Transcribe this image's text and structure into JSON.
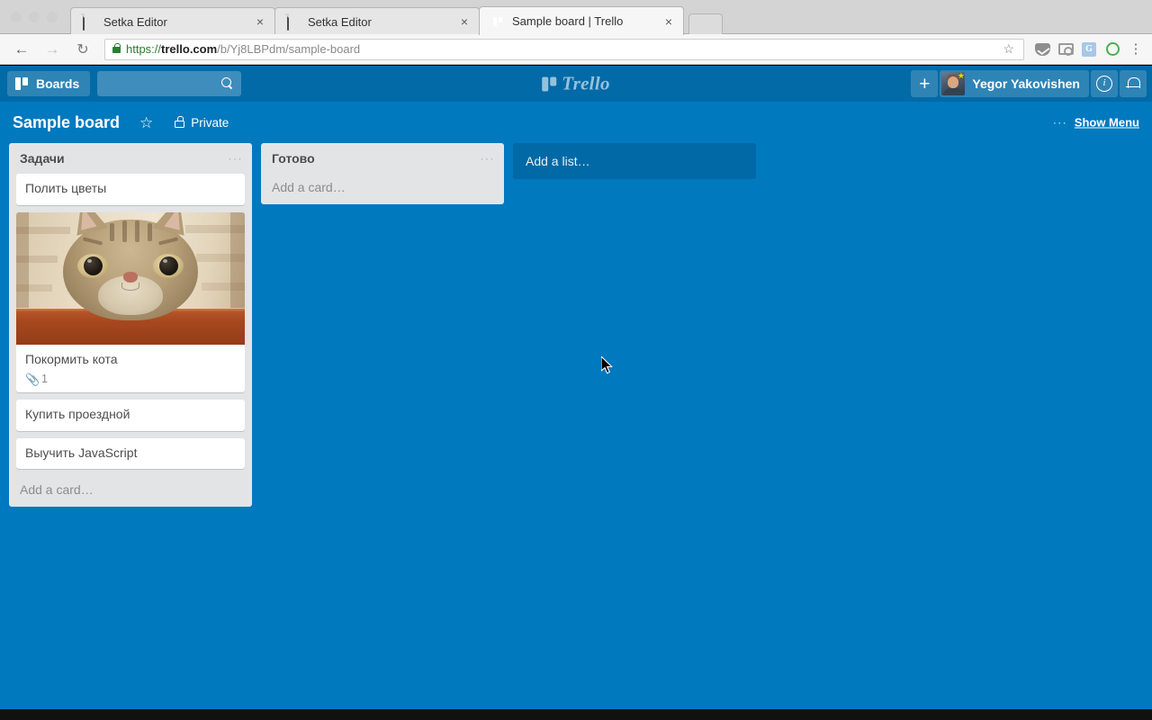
{
  "browser": {
    "window_buttons": [
      "close",
      "minimize",
      "maximize"
    ],
    "tabs": [
      {
        "title": "Setka Editor",
        "favicon": "document-icon",
        "active": false,
        "close_label": "×"
      },
      {
        "title": "Setka Editor",
        "favicon": "document-icon",
        "active": false,
        "close_label": "×"
      },
      {
        "title": "Sample board | Trello",
        "favicon": "trello-icon",
        "active": true,
        "close_label": "×"
      }
    ],
    "new_tab_label": "",
    "nav": {
      "back": "←",
      "forward": "→",
      "reload": "↻"
    },
    "address": {
      "scheme": "https://",
      "host": "trello.com",
      "path": "/b/Yj8LBPdm/sample-board",
      "full_url": "https://trello.com/b/Yj8LBPdm/sample-board",
      "secure": true,
      "bookmark_star": "☆"
    },
    "extensions": [
      "pocket-icon",
      "camera-icon",
      "google-translate-icon",
      "green-circle-icon",
      "chrome-menu-icon"
    ],
    "translate_letter": "G"
  },
  "trello_header": {
    "boards_label": "Boards",
    "search_placeholder": "",
    "search_value": "",
    "logo_text": "Trello",
    "add_label": "+",
    "member_name": "Yegor Yakovishen",
    "info_label": "i",
    "notifications_label": "bell"
  },
  "board": {
    "title": "Sample board",
    "starred": false,
    "visibility": "Private",
    "show_menu_label": "Show Menu",
    "menu_dots": "···",
    "background_color": "#0079BF",
    "lists": [
      {
        "name": "Задачи",
        "menu_dots": "···",
        "add_card_label": "Add a card…",
        "cards": [
          {
            "title": "Полить цветы",
            "cover": false
          },
          {
            "title": "Покормить кота",
            "cover": true,
            "cover_alt": "cat-photo",
            "attachments": "1"
          },
          {
            "title": "Купить проездной",
            "cover": false
          },
          {
            "title": "Выучить JavaScript",
            "cover": false
          }
        ]
      },
      {
        "name": "Готово",
        "menu_dots": "···",
        "add_card_label": "Add a card…",
        "cards": []
      }
    ],
    "add_list_label": "Add a list…"
  },
  "colors": {
    "trello_blue": "#0079BF",
    "header_blue": "#026AA7",
    "list_gray": "#E2E4E6",
    "card_white": "#FFFFFF",
    "text_gray": "#4D4D4D"
  }
}
